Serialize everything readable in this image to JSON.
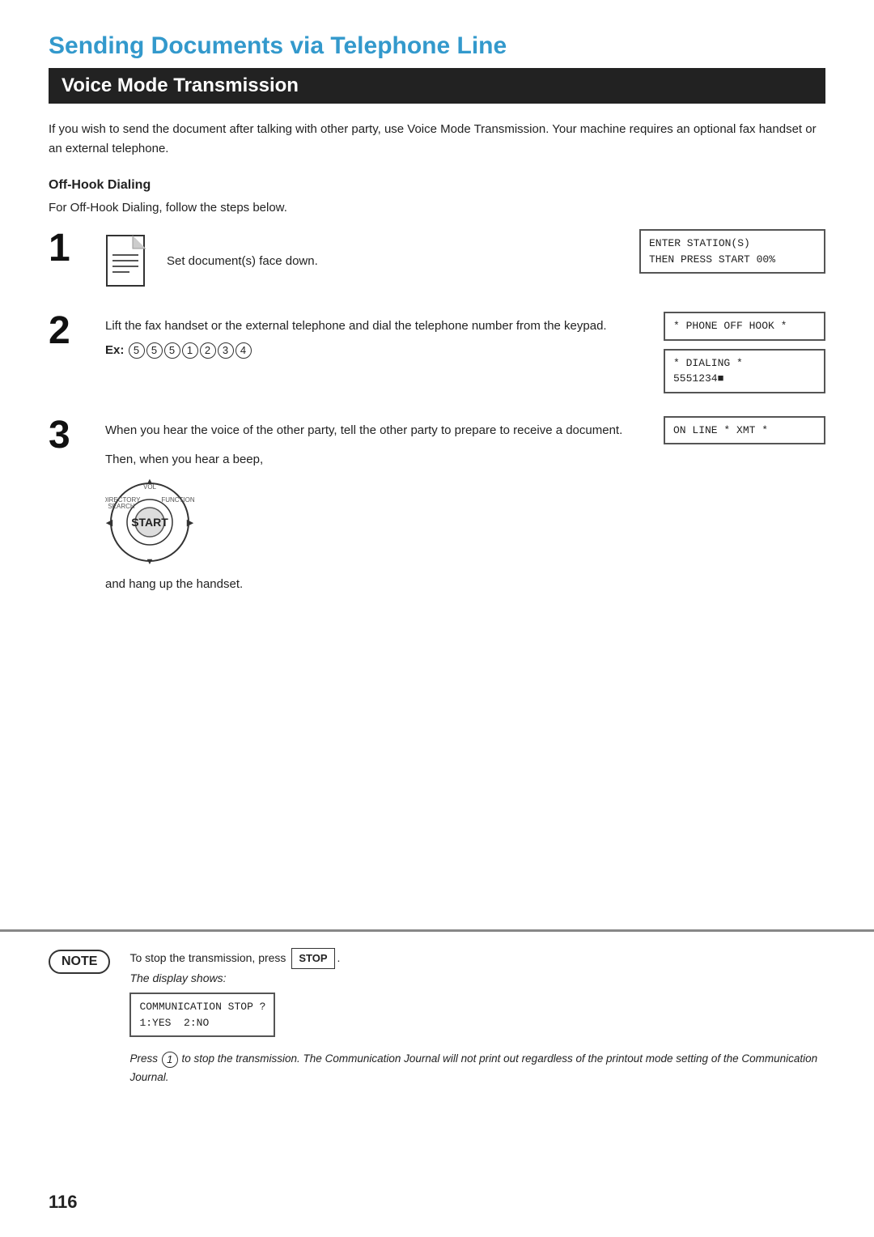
{
  "page": {
    "title": "Sending Documents via Telephone Line",
    "section_title": "Voice Mode Transmission",
    "intro": "If you wish to send the document after talking with other party, use Voice Mode Transmission.  Your machine requires an optional fax handset or an external telephone.",
    "subheading": "Off-Hook Dialing",
    "subheading_desc": "For Off-Hook Dialing, follow the steps below.",
    "page_number": "116"
  },
  "steps": [
    {
      "number": "1",
      "text": "Set document(s) face down.",
      "lcd": "ENTER STATION(S)\nTHEN PRESS START 00%"
    },
    {
      "number": "2",
      "text_1": "Lift the fax handset or the external telephone and dial the telephone number from the keypad.",
      "text_2": "Ex:",
      "digits": [
        "5",
        "5",
        "5",
        "1",
        "2",
        "3",
        "4"
      ],
      "lcd_1": "* PHONE OFF HOOK *",
      "lcd_2": "* DIALING *\n5551234■"
    },
    {
      "number": "3",
      "text_1": "When you hear the voice of the other party, tell the other party to prepare to receive a document.",
      "text_2": "Then, when you hear a beep,",
      "text_3": "and hang up the handset.",
      "lcd": "ON LINE * XMT *"
    }
  ],
  "note": {
    "label": "NOTE",
    "item_1_pre": "To stop the transmission, press ",
    "item_1_button": "STOP",
    "item_1_post": ".",
    "item_1_sub": "The display shows:",
    "lcd_text": "COMMUNICATION STOP ?\n1:YES  2:NO",
    "item_2": "Press",
    "item_2_circle": "1",
    "item_2_rest": " to stop the transmission. The Communication Journal will not print out regardless of the printout mode setting of the Communication Journal."
  },
  "icons": {
    "document": "document-icon",
    "start_button": "start-button-icon"
  }
}
